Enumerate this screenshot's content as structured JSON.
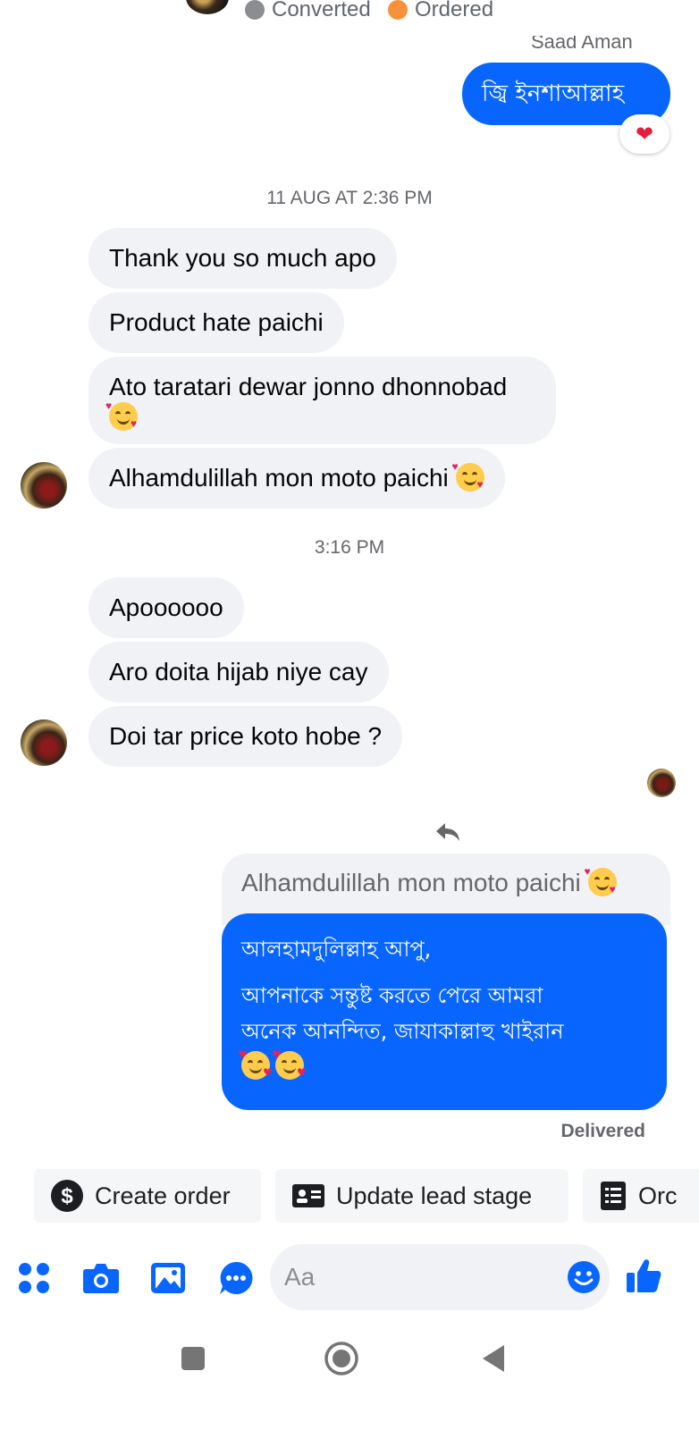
{
  "header": {
    "tags": [
      {
        "label": "Converted",
        "color": "#8a8d91"
      },
      {
        "label": "Ordered",
        "color": "#f7923a"
      }
    ],
    "sender_name": "Saad Aman"
  },
  "messages": {
    "out_first": "জ্বি ইনশাআল্লাহ",
    "reaction": "❤",
    "time1": "11 AUG AT 2:36 PM",
    "in1": "Thank you so much apo",
    "in2": "Product hate paichi",
    "in3": "Ato taratari dewar jonno dhonnobad",
    "in4": "Alhamdulillah mon moto paichi",
    "time2": "3:16 PM",
    "in5": "Apoooooo",
    "in6": "Aro doita hijab niye cay",
    "in7": "Doi tar price koto hobe ?",
    "quoted": "Alhamdulillah mon moto paichi",
    "reply_line1": "আলহামদুলিল্লাহ আপু,",
    "reply_line2": "আপনাকে সন্তুষ্ট করতে পেরে আমরা",
    "reply_line3": "অনেক আনন্দিত, জাযাকাল্লাহু খাইরান",
    "delivered": "Delivered"
  },
  "actions": {
    "create_order": "Create order",
    "update_lead": "Update lead stage",
    "orders": "Orc"
  },
  "composer": {
    "placeholder": "Aa"
  },
  "colors": {
    "accent": "#0866ff",
    "bubble_in": "#f0f2f5"
  }
}
